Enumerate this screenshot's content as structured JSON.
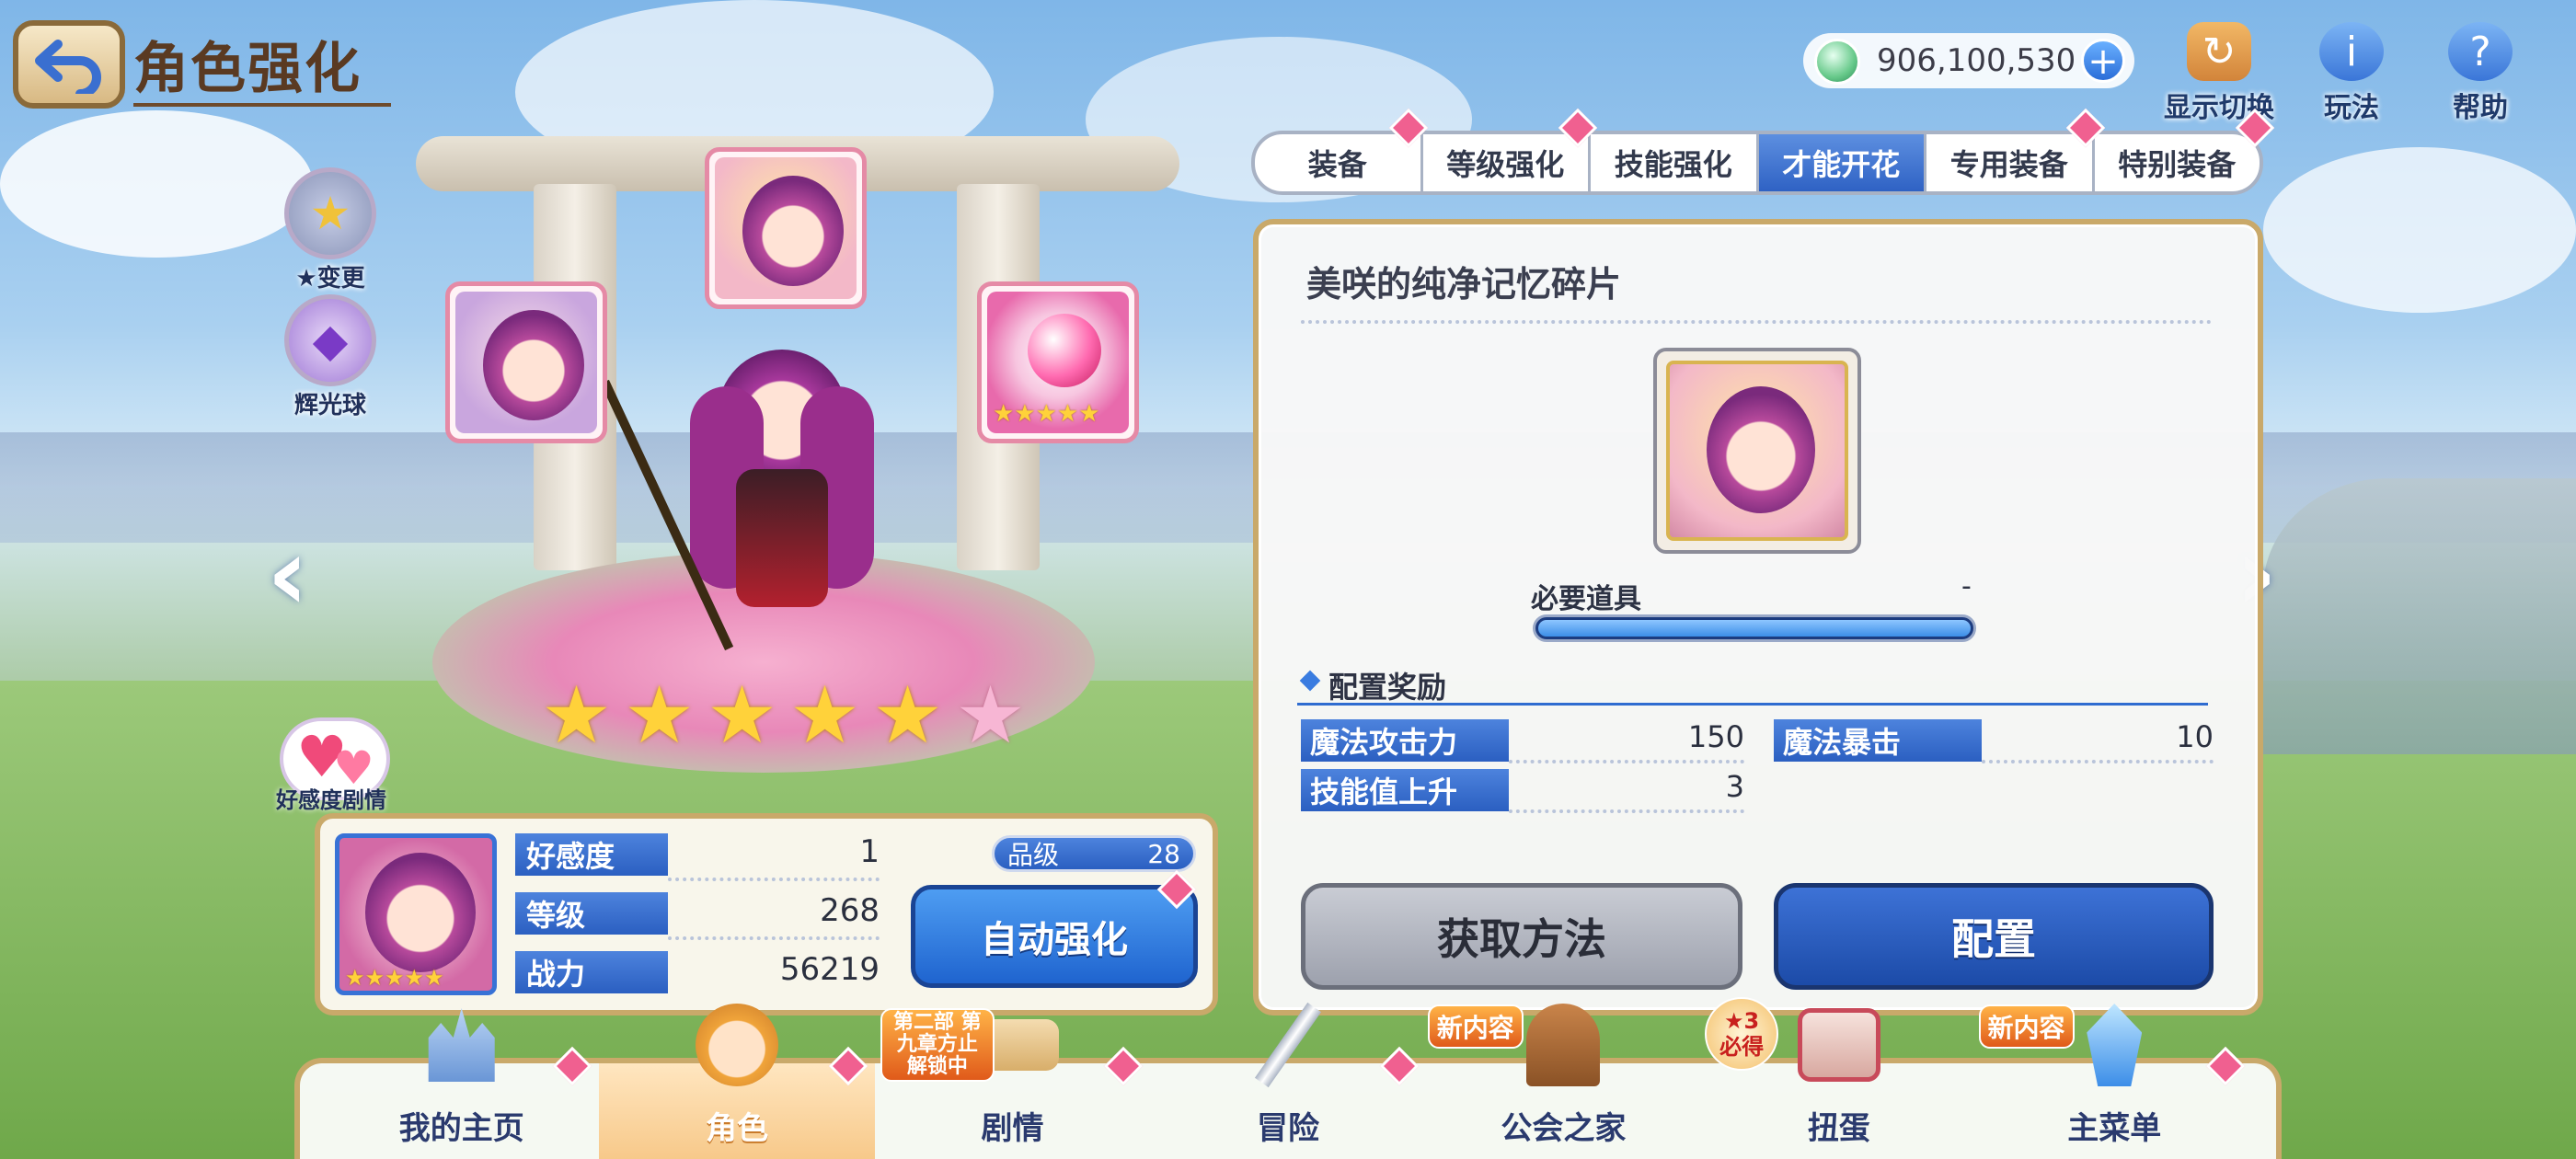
{
  "header": {
    "title": "角色强化",
    "currency_value": "906,100,530",
    "icons": [
      {
        "label": "显示切换",
        "icon": "display-switch-icon"
      },
      {
        "label": "玩法",
        "icon": "info-icon"
      },
      {
        "label": "帮助",
        "icon": "help-icon"
      }
    ]
  },
  "side_buttons": [
    {
      "label": "★变更",
      "icon": "star-change-icon"
    },
    {
      "label": "辉光球",
      "icon": "glow-orb-icon"
    }
  ],
  "tabs": [
    {
      "label": "装备",
      "active": false,
      "badge": true
    },
    {
      "label": "等级强化",
      "active": false,
      "badge": true
    },
    {
      "label": "技能强化",
      "active": false,
      "badge": false
    },
    {
      "label": "才能开花",
      "active": true,
      "badge": false
    },
    {
      "label": "专用装备",
      "active": false,
      "badge": true
    },
    {
      "label": "特别装备",
      "active": false,
      "badge": true
    }
  ],
  "panel": {
    "item_name": "美咲的纯净记忆碎片",
    "required_label": "必要道具",
    "required_value": "-",
    "required_fill": 1.0,
    "reward_title": "配置奖励",
    "stats": [
      {
        "label": "魔法攻击力",
        "value": "150"
      },
      {
        "label": "魔法暴击",
        "value": "10"
      },
      {
        "label": "技能值上升",
        "value": "3"
      }
    ],
    "obtain_button": "获取方法",
    "equip_button": "配置"
  },
  "character": {
    "stars": 5,
    "max_stars": 6,
    "affinity_story_label": "好感度剧情",
    "info": [
      {
        "label": "好感度",
        "value": "1"
      },
      {
        "label": "等级",
        "value": "268"
      },
      {
        "label": "战力",
        "value": "56219"
      }
    ],
    "rank_label": "品级",
    "rank_value": "28",
    "auto_button": "自动强化"
  },
  "bottom_nav": [
    {
      "label": "我的主页",
      "icon": "castle-icon",
      "active": false,
      "badge": "",
      "diamond": true
    },
    {
      "label": "角色",
      "icon": "character-icon",
      "active": true,
      "badge": "",
      "diamond": true
    },
    {
      "label": "剧情",
      "icon": "scroll-icon",
      "active": false,
      "badge": "第二部 第九章方止 解锁中",
      "diamond": true
    },
    {
      "label": "冒险",
      "icon": "sword-icon",
      "active": false,
      "badge": "",
      "diamond": true
    },
    {
      "label": "公会之家",
      "icon": "guild-door-icon",
      "active": false,
      "badge": "新内容",
      "diamond": false
    },
    {
      "label": "扭蛋",
      "icon": "gacha-icon",
      "active": false,
      "badge": "★3 必得",
      "diamond": false
    },
    {
      "label": "主菜单",
      "icon": "crystal-icon",
      "active": false,
      "badge": "新内容",
      "diamond": true
    }
  ],
  "colors": {
    "accent_blue": "#2f62c4",
    "gold_border": "#c9a96a",
    "badge_pink": "#f06090",
    "star_gold": "#ffd23a"
  }
}
